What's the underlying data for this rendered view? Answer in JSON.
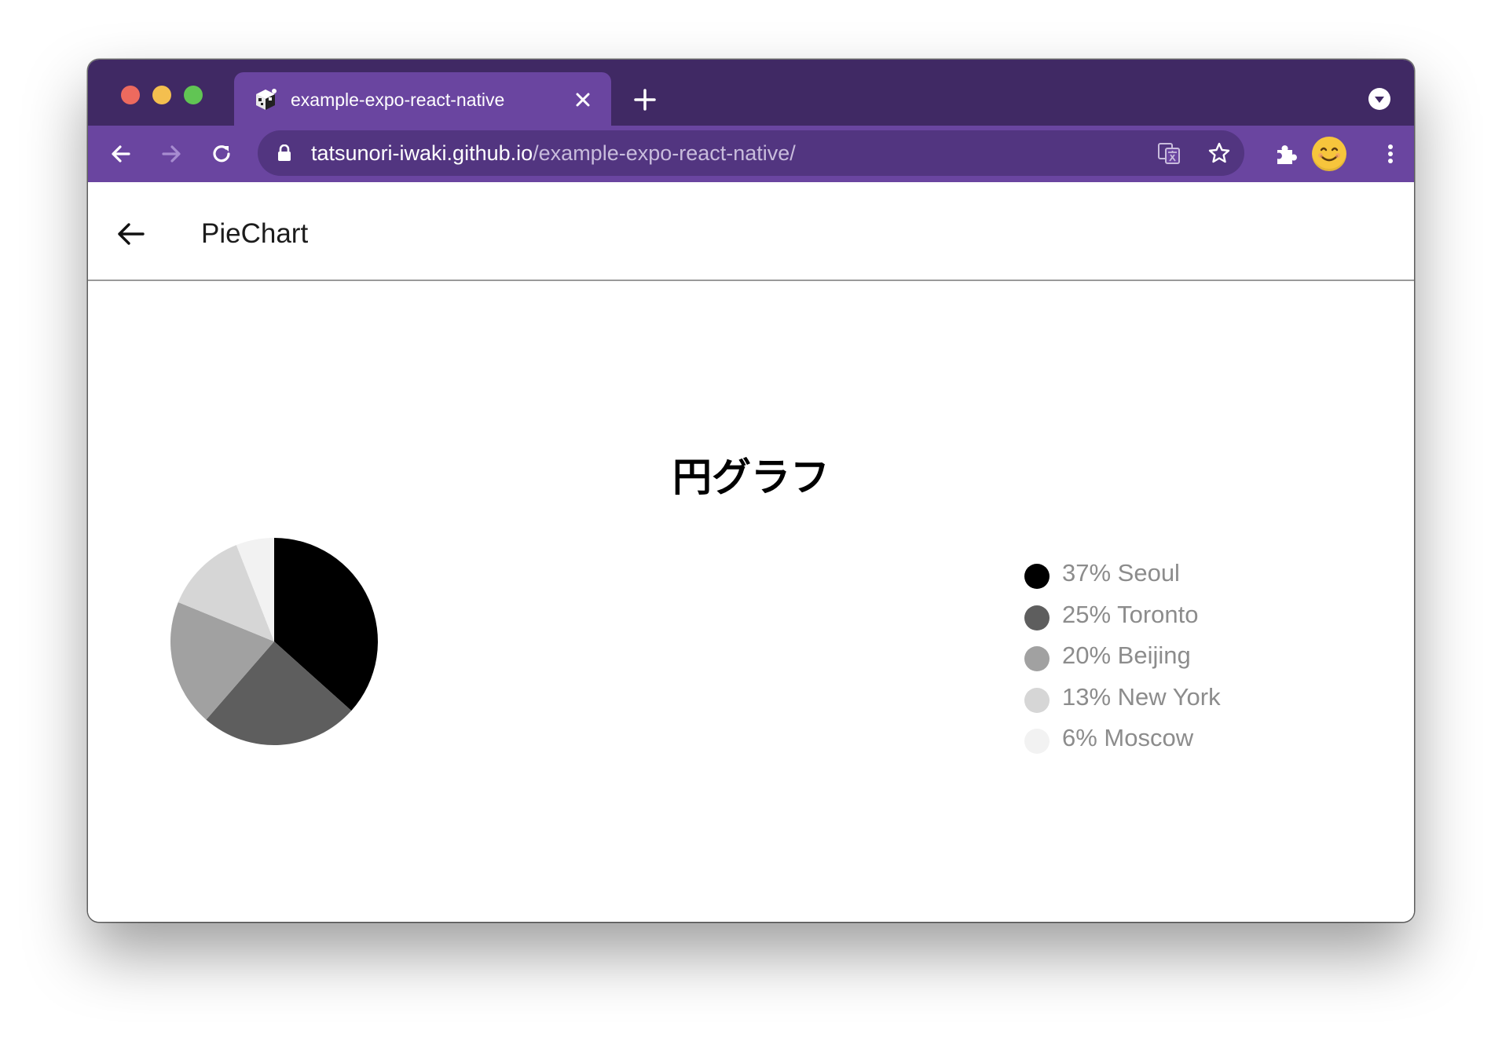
{
  "browser": {
    "tab_title": "example-expo-react-native",
    "url_host": "tatsunori-iwaki.github.io",
    "url_path": "/example-expo-react-native/",
    "accent_color": "#6a45a0",
    "tabstrip_color": "#402964",
    "icons": [
      "back-arrow-icon",
      "forward-arrow-icon",
      "reload-icon",
      "lock-icon",
      "translate-icon",
      "star-icon",
      "extensions-puzzle-icon",
      "profile-avatar-icon",
      "more-vertical-icon",
      "tab-search-icon",
      "new-tab-plus-icon",
      "close-icon"
    ]
  },
  "app": {
    "header_title": "PieChart",
    "chart_title": "円グラフ"
  },
  "chart_data": {
    "type": "pie",
    "title": "円グラフ",
    "slices": [
      {
        "label": "37% Seoul",
        "value": 37,
        "color": "#000000"
      },
      {
        "label": "25% Toronto",
        "value": 25,
        "color": "#5e5e5e"
      },
      {
        "label": "20% Beijing",
        "value": 20,
        "color": "#a1a1a1"
      },
      {
        "label": "13% New York",
        "value": 13,
        "color": "#d6d6d6"
      },
      {
        "label": "6% Moscow",
        "value": 6,
        "color": "#f2f2f2"
      }
    ],
    "legend_position": "right"
  }
}
